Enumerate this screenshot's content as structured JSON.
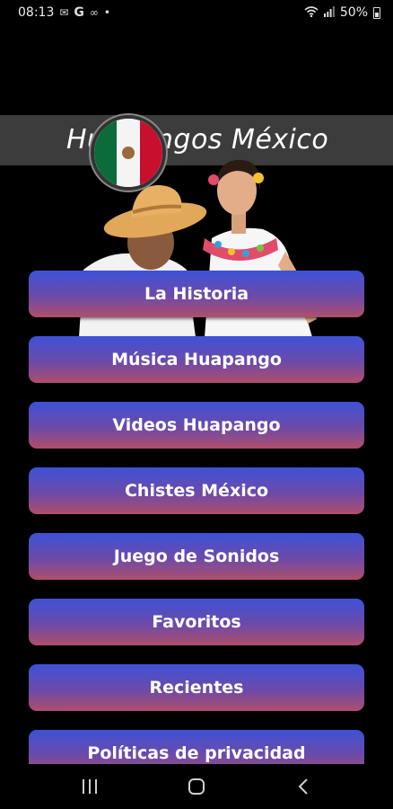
{
  "status_bar": {
    "time": "08:13",
    "google_glyph": "G",
    "battery": "50%",
    "icons": [
      "gmail-icon",
      "voicemail-icon",
      "wifi-icon",
      "signal-icon",
      "battery-icon"
    ]
  },
  "header": {
    "title": "Huapangos México",
    "emblem": "mexico-flag-icon"
  },
  "colors": {
    "button_top": "#3d52d8",
    "button_bottom": "#b04e6a",
    "background": "#000000"
  },
  "menu": {
    "items": [
      {
        "label": "La Historia"
      },
      {
        "label": "Música Huapango"
      },
      {
        "label": "Videos Huapango"
      },
      {
        "label": "Chistes México"
      },
      {
        "label": "Juego de Sonidos"
      },
      {
        "label": "Favoritos"
      },
      {
        "label": "Recientes"
      },
      {
        "label": "Políticas de privacidad"
      }
    ]
  },
  "nav_bar": {
    "icons": [
      "recent-apps-icon",
      "home-icon",
      "back-icon"
    ]
  }
}
